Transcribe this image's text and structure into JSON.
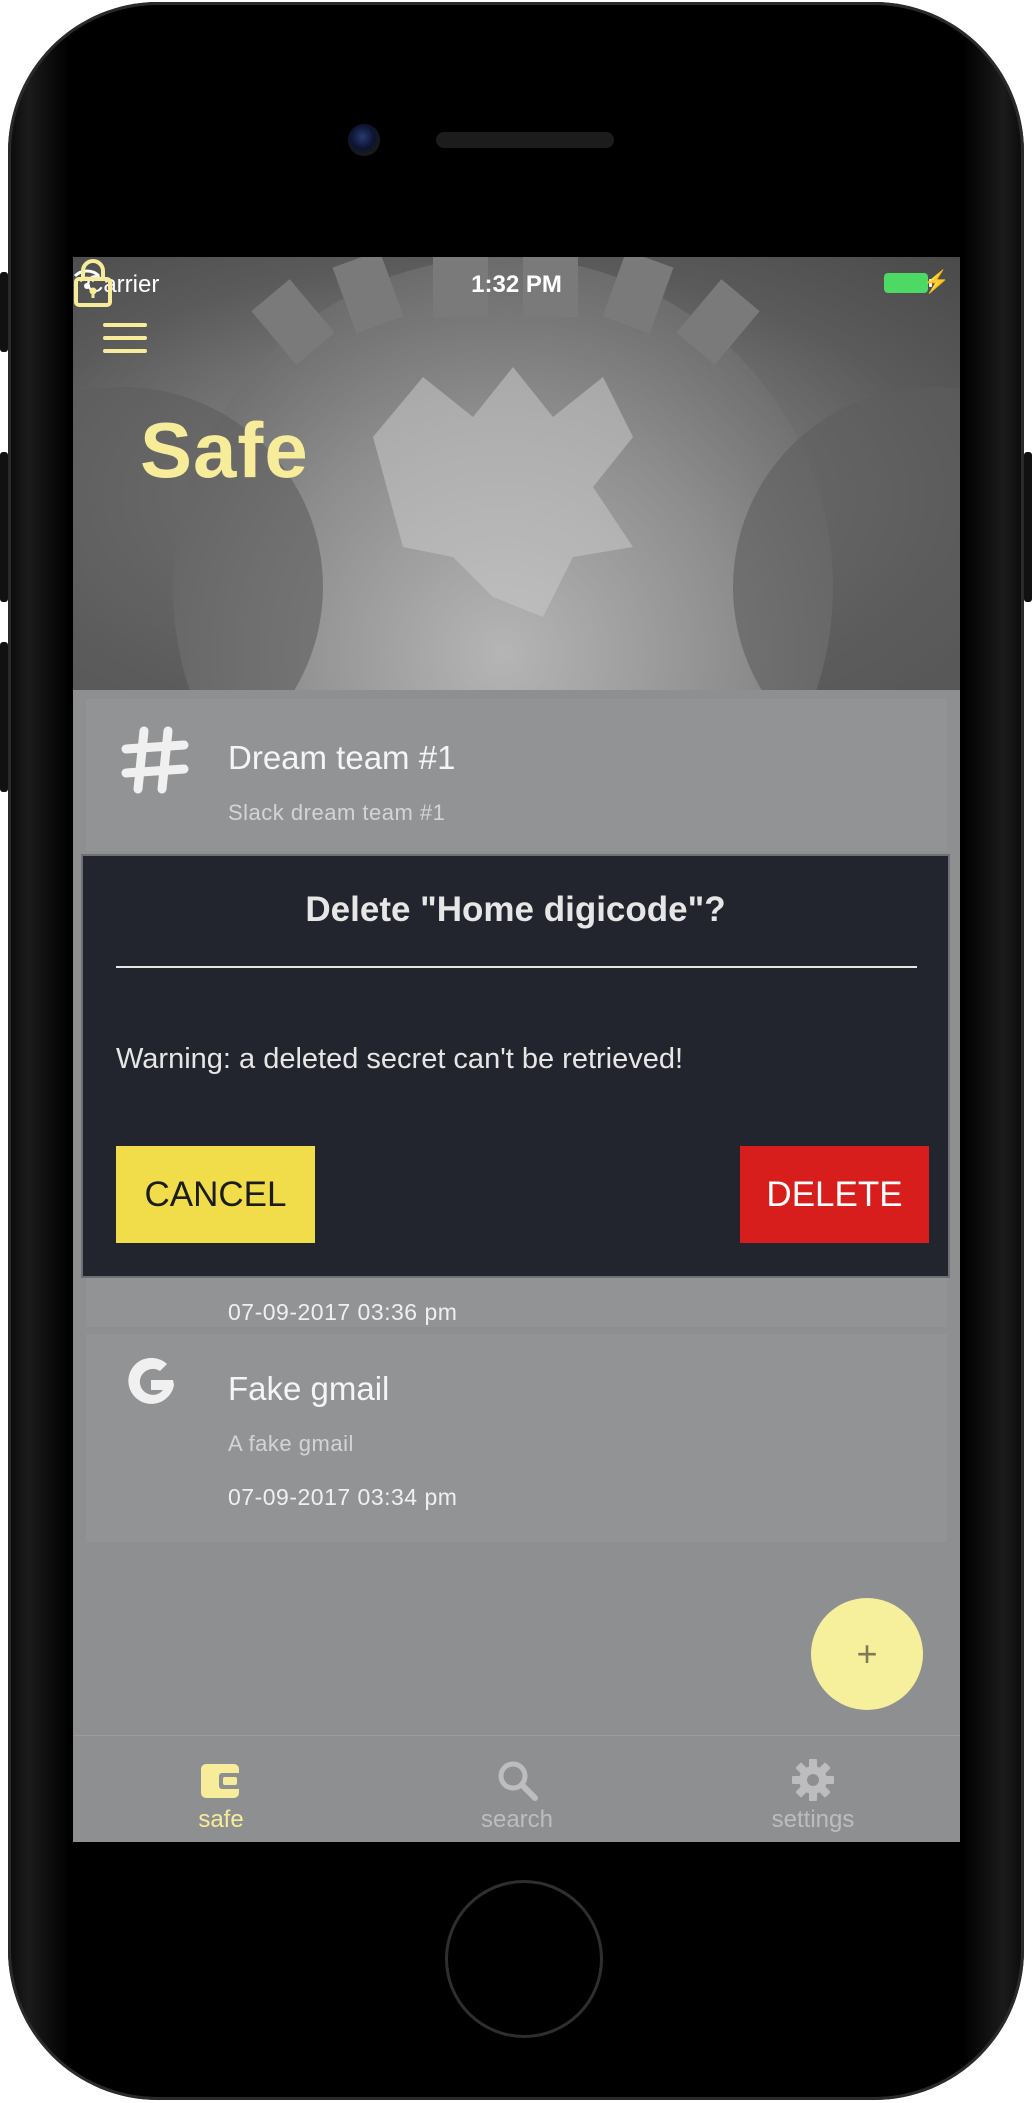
{
  "status_bar": {
    "carrier": "Carrier",
    "time": "1:32 PM"
  },
  "header": {
    "title": "Safe",
    "menu_icon": "hamburger-menu-icon",
    "lock_icon": "lock-icon"
  },
  "items": [
    {
      "icon": "slack-hash-icon",
      "title": "Dream team #1",
      "subtitle": "Slack dream team #1"
    },
    {
      "date": "07-09-2017 03:36 pm"
    },
    {
      "icon": "google-icon",
      "title": "Fake gmail",
      "subtitle": "A fake gmail",
      "date": "07-09-2017 03:34 pm"
    }
  ],
  "dialog": {
    "title": "Delete \"Home digicode\"?",
    "message": "Warning: a deleted secret can't be retrieved!",
    "cancel_label": "CANCEL",
    "delete_label": "DELETE"
  },
  "fab": {
    "label": "+"
  },
  "tabs": [
    {
      "label": "safe",
      "icon": "wallet-icon",
      "active": true
    },
    {
      "label": "search",
      "icon": "search-icon",
      "active": false
    },
    {
      "label": "settings",
      "icon": "gear-icon",
      "active": false
    }
  ],
  "colors": {
    "accent": "#f6ec99",
    "dialog_bg": "#22252d",
    "cancel_bg": "#f0dd49",
    "delete_bg": "#d81d1d",
    "tab_inactive": "#bdbdbf"
  }
}
